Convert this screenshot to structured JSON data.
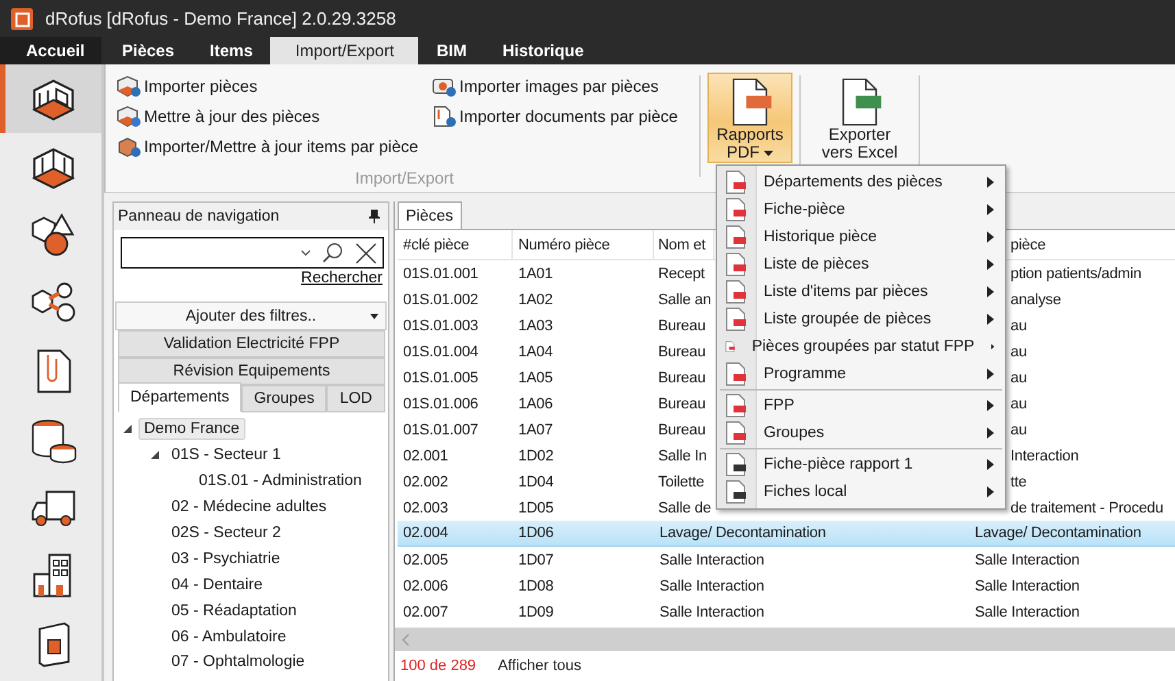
{
  "window": {
    "title": "dRofus [dRofus - Demo France] 2.0.29.3258"
  },
  "menu_tabs": [
    {
      "label": "Accueil",
      "selected": false
    },
    {
      "label": "Pièces",
      "selected": false
    },
    {
      "label": "Items",
      "selected": false
    },
    {
      "label": "Import/Export",
      "selected": true
    },
    {
      "label": "BIM",
      "selected": false
    },
    {
      "label": "Historique",
      "selected": false
    }
  ],
  "sidebar": {
    "items": [
      {
        "kind": "room",
        "selected": true
      },
      {
        "kind": "room-open",
        "selected": false
      },
      {
        "kind": "shapes",
        "selected": false
      },
      {
        "kind": "linked-shapes",
        "selected": false
      },
      {
        "kind": "attachment",
        "selected": false
      },
      {
        "kind": "database",
        "selected": false
      },
      {
        "kind": "truck",
        "selected": false
      },
      {
        "kind": "building",
        "selected": false
      },
      {
        "kind": "door",
        "selected": false
      }
    ]
  },
  "ribbon": {
    "group_label": "Import/Export",
    "import_columns": [
      [
        {
          "label": "Importer pièces",
          "kind": "import-rooms"
        },
        {
          "label": "Mettre à jour des pièces",
          "kind": "update-rooms"
        },
        {
          "label": "Importer/Mettre à jour items par pièce",
          "kind": "import-items"
        }
      ],
      [
        {
          "label": "Importer images par pièces",
          "kind": "import-images"
        },
        {
          "label": "Importer documents par pièce",
          "kind": "import-documents"
        }
      ]
    ],
    "buttons": [
      {
        "label": "Rapports PDF",
        "kind": "pdf",
        "active": true,
        "dropdown": true
      },
      {
        "label": "Exporter vers Excel",
        "kind": "excel",
        "active": false,
        "dropdown": false
      }
    ]
  },
  "navigation_panel": {
    "title": "Panneau de navigation",
    "search_link": "Rechercher",
    "filter_button": "Ajouter des filtres..",
    "views": [
      "Validation Electricité FPP",
      "Révision Equipements"
    ],
    "tabs": [
      {
        "label": "Départements",
        "selected": true
      },
      {
        "label": "Groupes",
        "selected": false
      },
      {
        "label": "LOD",
        "selected": false
      }
    ],
    "tree": [
      {
        "label": "Demo France",
        "selected": true,
        "expanded": true,
        "children": [
          {
            "label": "01S - Secteur 1",
            "selected": false,
            "expanded": true,
            "children": [
              {
                "label": "01S.01 - Administration",
                "selected": false
              }
            ]
          },
          {
            "label": "02 - Médecine adultes",
            "selected": false
          },
          {
            "label": "02S - Secteur 2",
            "selected": false
          },
          {
            "label": "03 - Psychiatrie",
            "selected": false
          },
          {
            "label": "04 - Dentaire",
            "selected": false
          },
          {
            "label": "05 - Réadaptation",
            "selected": false
          },
          {
            "label": "06 - Ambulatoire",
            "selected": false
          },
          {
            "label": "07 - Ophtalmologie",
            "selected": false
          }
        ]
      }
    ]
  },
  "table": {
    "tab": {
      "label": "Pièces",
      "selected": true
    },
    "columns": [
      {
        "label": "#clé pièce",
        "under_menu": false
      },
      {
        "label": "Numéro pièce",
        "under_menu": false
      },
      {
        "label": "Nom et",
        "under_menu": true
      },
      {
        "label": "pièce",
        "under_menu": true
      }
    ],
    "rows": [
      {
        "cells": [
          "01S.01.001",
          "1A01",
          "Recept",
          "ption patients/admin"
        ],
        "selected": false,
        "under_menu": true
      },
      {
        "cells": [
          "01S.01.002",
          "1A02",
          "Salle an",
          "analyse"
        ],
        "selected": false,
        "under_menu": true
      },
      {
        "cells": [
          "01S.01.003",
          "1A03",
          "Bureau",
          "au"
        ],
        "selected": false,
        "under_menu": true
      },
      {
        "cells": [
          "01S.01.004",
          "1A04",
          "Bureau",
          "au"
        ],
        "selected": false,
        "under_menu": true
      },
      {
        "cells": [
          "01S.01.005",
          "1A05",
          "Bureau",
          "au"
        ],
        "selected": false,
        "under_menu": true
      },
      {
        "cells": [
          "01S.01.006",
          "1A06",
          "Bureau",
          "au"
        ],
        "selected": false,
        "under_menu": true
      },
      {
        "cells": [
          "01S.01.007",
          "1A07",
          "Bureau",
          "au"
        ],
        "selected": false,
        "under_menu": true
      },
      {
        "cells": [
          "02.001",
          "1D02",
          "Salle In",
          "Interaction"
        ],
        "selected": false,
        "under_menu": true
      },
      {
        "cells": [
          "02.002",
          "1D04",
          "Toilette",
          "tte"
        ],
        "selected": false,
        "under_menu": true
      },
      {
        "cells": [
          "02.003",
          "1D05",
          "Salle de",
          "de traitement - Procedu"
        ],
        "selected": false,
        "under_menu": true
      },
      {
        "cells": [
          "02.004",
          "1D06",
          "Lavage/ Decontamination",
          "Lavage/ Decontamination"
        ],
        "selected": true,
        "under_menu": false
      },
      {
        "cells": [
          "02.005",
          "1D07",
          "Salle Interaction",
          "Salle Interaction"
        ],
        "selected": false,
        "under_menu": false
      },
      {
        "cells": [
          "02.006",
          "1D08",
          "Salle Interaction",
          "Salle Interaction"
        ],
        "selected": false,
        "under_menu": false
      },
      {
        "cells": [
          "02.007",
          "1D09",
          "Salle Interaction",
          "Salle Interaction"
        ],
        "selected": false,
        "under_menu": false
      }
    ],
    "count": "100 de 289",
    "show_all": "Afficher tous"
  },
  "pdf_menu": {
    "sections": [
      [
        {
          "label": "Départements des pièces",
          "kind": "pdf",
          "submenu": true
        },
        {
          "label": "Fiche-pièce",
          "kind": "pdf",
          "submenu": true
        },
        {
          "label": "Historique pièce",
          "kind": "pdf",
          "submenu": true
        },
        {
          "label": "Liste de pièces",
          "kind": "pdf",
          "submenu": true
        },
        {
          "label": "Liste d'items par pièces",
          "kind": "pdf",
          "submenu": true
        },
        {
          "label": "Liste groupée de pièces",
          "kind": "pdf",
          "submenu": true
        },
        {
          "label": "Pièces groupées par statut FPP",
          "kind": "pdf",
          "submenu": true
        },
        {
          "label": "Programme",
          "kind": "pdf",
          "submenu": true
        }
      ],
      [
        {
          "label": "FPP",
          "kind": "pdf",
          "submenu": true
        },
        {
          "label": "Groupes",
          "kind": "pdf",
          "submenu": true
        }
      ],
      [
        {
          "label": "Fiche-pièce rapport 1",
          "kind": "custom",
          "submenu": true
        },
        {
          "label": "Fiches local",
          "kind": "custom",
          "submenu": true
        }
      ]
    ]
  }
}
